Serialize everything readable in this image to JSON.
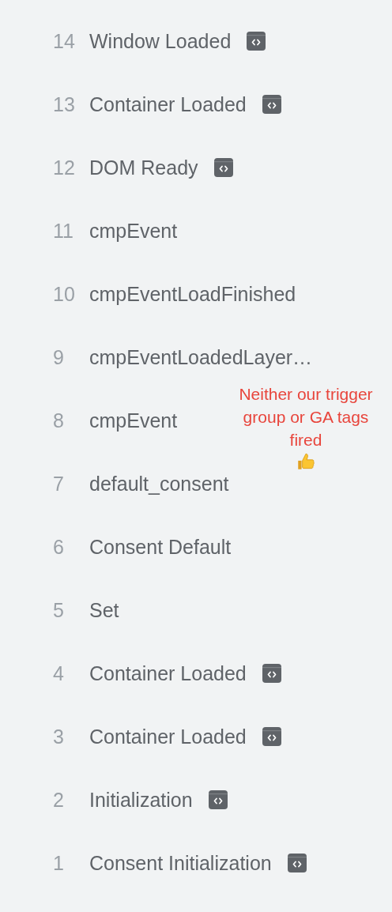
{
  "events": [
    {
      "number": "14",
      "name": "Window Loaded",
      "code_icon": true
    },
    {
      "number": "13",
      "name": "Container Loaded",
      "code_icon": true
    },
    {
      "number": "12",
      "name": "DOM Ready",
      "code_icon": true
    },
    {
      "number": "11",
      "name": "cmpEvent",
      "code_icon": false
    },
    {
      "number": "10",
      "name": "cmpEventLoadFinished",
      "code_icon": false
    },
    {
      "number": "9",
      "name": "cmpEventLoadedLayer…",
      "code_icon": false
    },
    {
      "number": "8",
      "name": "cmpEvent",
      "code_icon": false
    },
    {
      "number": "7",
      "name": "default_consent",
      "code_icon": false
    },
    {
      "number": "6",
      "name": "Consent Default",
      "code_icon": false
    },
    {
      "number": "5",
      "name": "Set",
      "code_icon": false
    },
    {
      "number": "4",
      "name": "Container Loaded",
      "code_icon": true
    },
    {
      "number": "3",
      "name": "Container Loaded",
      "code_icon": true
    },
    {
      "number": "2",
      "name": "Initialization",
      "code_icon": true
    },
    {
      "number": "1",
      "name": "Consent Initialization",
      "code_icon": true
    }
  ],
  "annotation": {
    "text": "Neither our trigger group or GA tags fired"
  }
}
